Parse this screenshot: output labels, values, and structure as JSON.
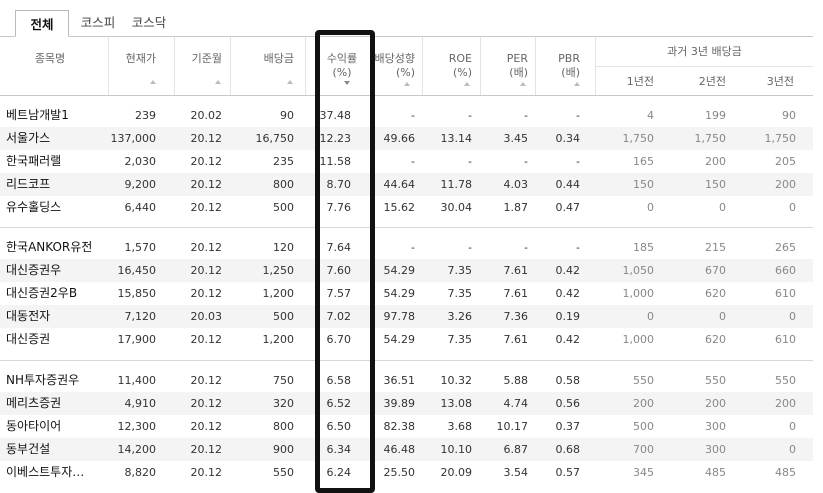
{
  "tabs": [
    {
      "label": "전체",
      "active": true
    },
    {
      "label": "코스피",
      "active": false
    },
    {
      "label": "코스닥",
      "active": false
    }
  ],
  "headers": {
    "name": "종목명",
    "price": "현재가",
    "base_month": "기준월",
    "dividend": "배당금",
    "yield_l1": "수익률",
    "yield_l2": "(%)",
    "payout_l1": "배당성향",
    "payout_l2": "(%)",
    "roe_l1": "ROE",
    "roe_l2": "(%)",
    "per_l1": "PER",
    "per_l2": "(배)",
    "pbr_l1": "PBR",
    "pbr_l2": "(배)",
    "past_group": "과거 3년 배당금",
    "y1": "1년전",
    "y2": "2년전",
    "y3": "3년전"
  },
  "groups": [
    [
      {
        "name": "베트남개발1",
        "price": "239",
        "base": "20.02",
        "div": "90",
        "yield": "37.48",
        "payout": "-",
        "roe": "-",
        "per": "-",
        "pbr": "-",
        "y1": "4",
        "y2": "199",
        "y3": "90"
      },
      {
        "name": "서울가스",
        "price": "137,000",
        "base": "20.12",
        "div": "16,750",
        "yield": "12.23",
        "payout": "49.66",
        "roe": "13.14",
        "per": "3.45",
        "pbr": "0.34",
        "y1": "1,750",
        "y2": "1,750",
        "y3": "1,750"
      },
      {
        "name": "한국패러랠",
        "price": "2,030",
        "base": "20.12",
        "div": "235",
        "yield": "11.58",
        "payout": "-",
        "roe": "-",
        "per": "-",
        "pbr": "-",
        "y1": "165",
        "y2": "200",
        "y3": "205"
      },
      {
        "name": "리드코프",
        "price": "9,200",
        "base": "20.12",
        "div": "800",
        "yield": "8.70",
        "payout": "44.64",
        "roe": "11.78",
        "per": "4.03",
        "pbr": "0.44",
        "y1": "150",
        "y2": "150",
        "y3": "200"
      },
      {
        "name": "유수홀딩스",
        "price": "6,440",
        "base": "20.12",
        "div": "500",
        "yield": "7.76",
        "payout": "15.62",
        "roe": "30.04",
        "per": "1.87",
        "pbr": "0.47",
        "y1": "0",
        "y2": "0",
        "y3": "0"
      }
    ],
    [
      {
        "name": "한국ANKOR유전",
        "price": "1,570",
        "base": "20.12",
        "div": "120",
        "yield": "7.64",
        "payout": "-",
        "roe": "-",
        "per": "-",
        "pbr": "-",
        "y1": "185",
        "y2": "215",
        "y3": "265"
      },
      {
        "name": "대신증권우",
        "price": "16,450",
        "base": "20.12",
        "div": "1,250",
        "yield": "7.60",
        "payout": "54.29",
        "roe": "7.35",
        "per": "7.61",
        "pbr": "0.42",
        "y1": "1,050",
        "y2": "670",
        "y3": "660"
      },
      {
        "name": "대신증권2우B",
        "price": "15,850",
        "base": "20.12",
        "div": "1,200",
        "yield": "7.57",
        "payout": "54.29",
        "roe": "7.35",
        "per": "7.61",
        "pbr": "0.42",
        "y1": "1,000",
        "y2": "620",
        "y3": "610"
      },
      {
        "name": "대동전자",
        "price": "7,120",
        "base": "20.03",
        "div": "500",
        "yield": "7.02",
        "payout": "97.78",
        "roe": "3.26",
        "per": "7.36",
        "pbr": "0.19",
        "y1": "0",
        "y2": "0",
        "y3": "0"
      },
      {
        "name": "대신증권",
        "price": "17,900",
        "base": "20.12",
        "div": "1,200",
        "yield": "6.70",
        "payout": "54.29",
        "roe": "7.35",
        "per": "7.61",
        "pbr": "0.42",
        "y1": "1,000",
        "y2": "620",
        "y3": "610"
      }
    ],
    [
      {
        "name": "NH투자증권우",
        "price": "11,400",
        "base": "20.12",
        "div": "750",
        "yield": "6.58",
        "payout": "36.51",
        "roe": "10.32",
        "per": "5.88",
        "pbr": "0.58",
        "y1": "550",
        "y2": "550",
        "y3": "550"
      },
      {
        "name": "메리츠증권",
        "price": "4,910",
        "base": "20.12",
        "div": "320",
        "yield": "6.52",
        "payout": "39.89",
        "roe": "13.08",
        "per": "4.74",
        "pbr": "0.56",
        "y1": "200",
        "y2": "200",
        "y3": "200"
      },
      {
        "name": "동아타이어",
        "price": "12,300",
        "base": "20.12",
        "div": "800",
        "yield": "6.50",
        "payout": "82.38",
        "roe": "3.68",
        "per": "10.17",
        "pbr": "0.37",
        "y1": "500",
        "y2": "300",
        "y3": "0"
      },
      {
        "name": "동부건설",
        "price": "14,200",
        "base": "20.12",
        "div": "900",
        "yield": "6.34",
        "payout": "46.48",
        "roe": "10.10",
        "per": "6.87",
        "pbr": "0.68",
        "y1": "700",
        "y2": "300",
        "y3": "0"
      },
      {
        "name": "이베스트투자…",
        "price": "8,820",
        "base": "20.12",
        "div": "550",
        "yield": "6.24",
        "payout": "25.50",
        "roe": "20.09",
        "per": "3.54",
        "pbr": "0.57",
        "y1": "345",
        "y2": "485",
        "y3": "485"
      }
    ]
  ]
}
